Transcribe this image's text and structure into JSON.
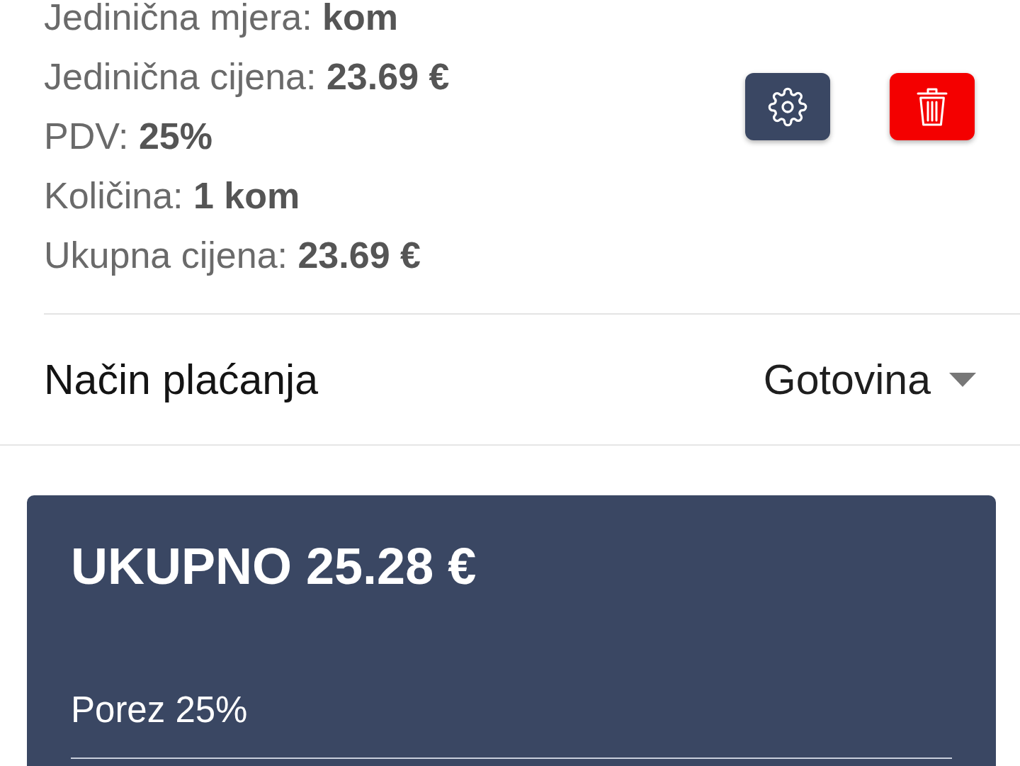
{
  "item_details": [
    "Jedinična mjera: **kom**",
    "Jedinična cijena: **23.69 €**",
    "PDV: **25%**",
    "Količina: **1 kom**",
    "Ukupna cijena: **23.69 €**"
  ],
  "item_actions": [
    {
      "kind": "settings"
    },
    {
      "kind": "delete"
    }
  ],
  "payment": {
    "label": "Način plaćanja",
    "value": "Gotovina"
  },
  "summary": {
    "total": "UKUPNO 25.28 €",
    "tax_label": "Porez 25%"
  }
}
